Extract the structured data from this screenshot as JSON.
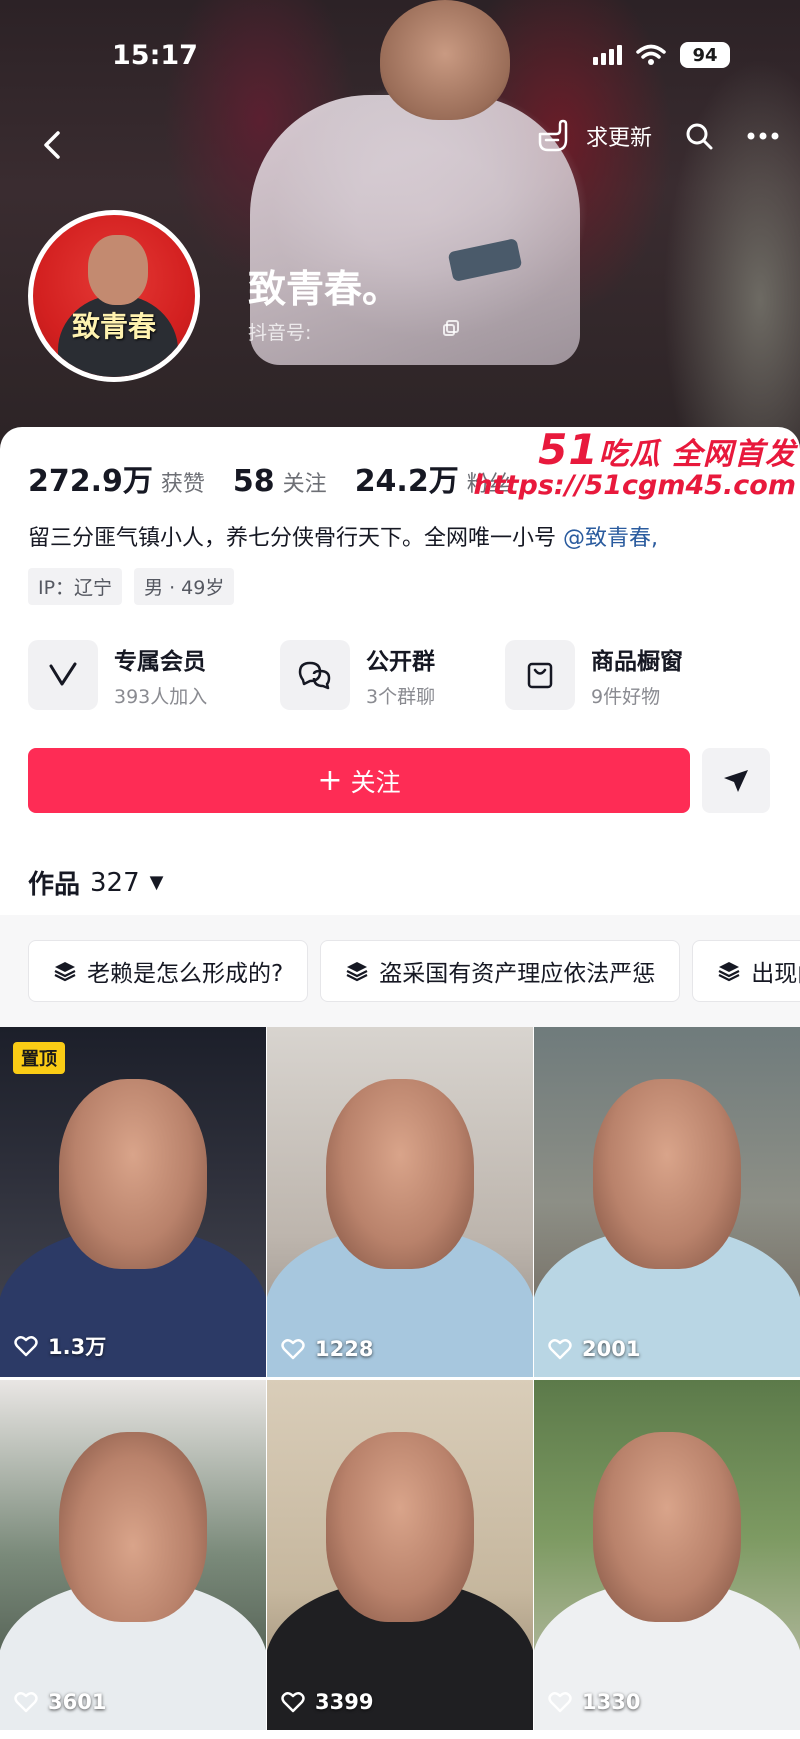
{
  "status_bar": {
    "time": "15:17",
    "battery": "94"
  },
  "nav": {
    "request_update": "求更新"
  },
  "profile": {
    "avatar_text": "致青春",
    "nickname": "致青春。",
    "douyin_id_label": "抖音号:",
    "stats": [
      {
        "value": "272.9万",
        "label": "获赞"
      },
      {
        "value": "58",
        "label": "关注"
      },
      {
        "value": "24.2万",
        "label": "粉丝"
      }
    ],
    "bio_text": "留三分匪气镇小人，养七分侠骨行天下。全网唯一小号",
    "bio_mention": "@致青春,",
    "tags": [
      "IP：辽宁",
      "男 · 49岁"
    ]
  },
  "watermark": {
    "number": "51",
    "text": "吃瓜 全网首发",
    "url": "https://51cgm45.com"
  },
  "services": [
    {
      "title": "专属会员",
      "subtitle": "393人加入",
      "icon": "vip-v-icon"
    },
    {
      "title": "公开群",
      "subtitle": "3个群聊",
      "icon": "group-chat-icon"
    },
    {
      "title": "商品橱窗",
      "subtitle": "9件好物",
      "icon": "shop-bag-icon"
    }
  ],
  "actions": {
    "follow_label": "关注"
  },
  "works": {
    "label": "作品",
    "count": "327"
  },
  "collections": [
    "老赖是怎么形成的?",
    "盗采国有资产理应依法严惩",
    "出现门"
  ],
  "videos": [
    {
      "likes": "1.3万",
      "pinned_label": "置顶"
    },
    {
      "likes": "1228"
    },
    {
      "likes": "2001"
    },
    {
      "likes": "3601"
    },
    {
      "likes": "3399"
    },
    {
      "likes": "1330"
    }
  ],
  "colors": {
    "accent": "#fe2c55",
    "watermark": "#e8193c",
    "mention": "#2a5b9e"
  }
}
